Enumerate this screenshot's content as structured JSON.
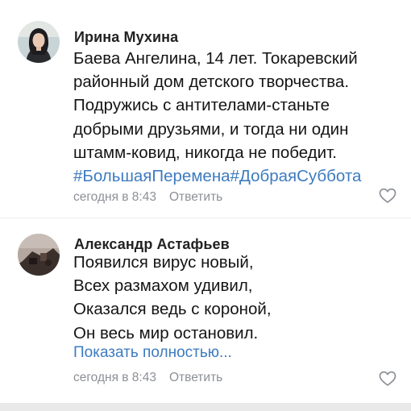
{
  "comments": [
    {
      "author": "Ирина Мухина",
      "text_lines": [
        "Баева Ангелина, 14 лет. Токаревский",
        "районный дом детского творчества.",
        "Подружись с антителами-станьте",
        "добрыми друзьями, и тогда ни один",
        "штамм-ковид, никогда не победит."
      ],
      "hashtags": "#БольшаяПеремена#ДобраяСуббота",
      "time": "сегодня в 8:43",
      "reply_label": "Ответить",
      "avatar_icon": "user-photo-woman"
    },
    {
      "author": "Александр Астафьев",
      "text_lines": [
        "Появился вирус новый,",
        "Всех размахом удивил,",
        "Оказался ведь с короной,",
        "Он весь мир остановил."
      ],
      "show_more_label": "Показать полностью...",
      "time": "сегодня в 8:43",
      "reply_label": "Ответить",
      "avatar_icon": "user-photo-dark"
    }
  ],
  "colors": {
    "link": "#3d7bc0",
    "meta": "#8c9096",
    "text": "#141414"
  }
}
